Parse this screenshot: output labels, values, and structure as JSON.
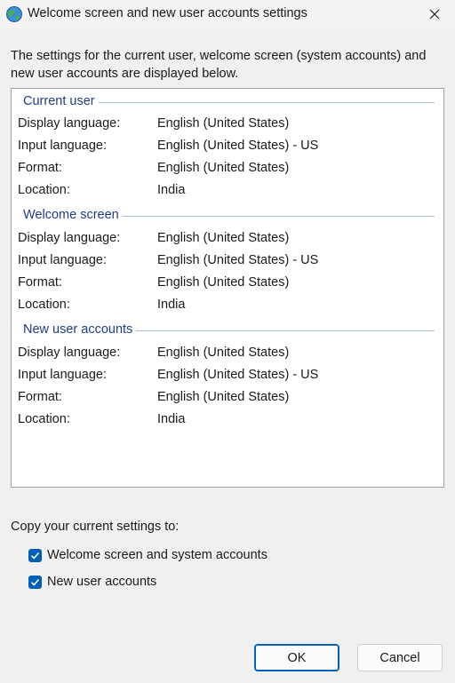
{
  "window": {
    "title": "Welcome screen and new user accounts settings",
    "icon": "globe-icon",
    "close_icon": "close-icon"
  },
  "description": "The settings for the current user, welcome screen (system accounts) and new user accounts are displayed below.",
  "sections": [
    {
      "title": "Current user",
      "rows": [
        {
          "label": "Display language:",
          "value": "English (United States)"
        },
        {
          "label": "Input language:",
          "value": "English (United States) - US"
        },
        {
          "label": "Format:",
          "value": "English (United States)"
        },
        {
          "label": "Location:",
          "value": "India"
        }
      ]
    },
    {
      "title": "Welcome screen",
      "rows": [
        {
          "label": "Display language:",
          "value": "English (United States)"
        },
        {
          "label": "Input language:",
          "value": "English (United States) - US"
        },
        {
          "label": "Format:",
          "value": "English (United States)"
        },
        {
          "label": "Location:",
          "value": "India"
        }
      ]
    },
    {
      "title": "New user accounts",
      "rows": [
        {
          "label": "Display language:",
          "value": "English (United States)"
        },
        {
          "label": "Input language:",
          "value": "English (United States) - US"
        },
        {
          "label": "Format:",
          "value": "English (United States)"
        },
        {
          "label": "Location:",
          "value": "India"
        }
      ]
    }
  ],
  "copy": {
    "label": "Copy your current settings to:",
    "options": [
      {
        "label": "Welcome screen and system accounts",
        "checked": true
      },
      {
        "label": "New user accounts",
        "checked": true
      }
    ]
  },
  "buttons": {
    "ok": "OK",
    "cancel": "Cancel"
  },
  "colors": {
    "accent": "#005fb8",
    "section_title": "#1f3c88"
  }
}
